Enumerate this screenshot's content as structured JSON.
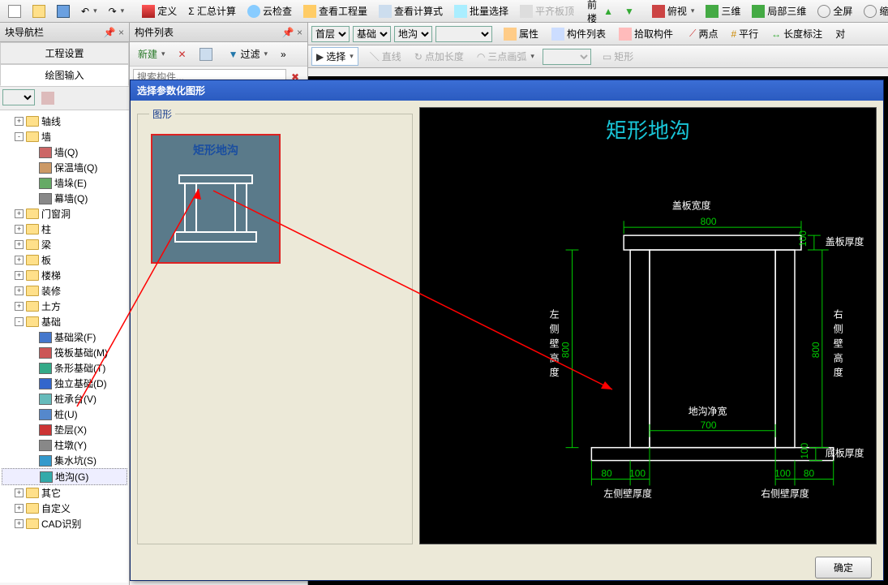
{
  "top_toolbar": {
    "define": "定义",
    "sum": "Σ 汇总计算",
    "cloud": "云检查",
    "view_qty": "查看工程量",
    "view_calc": "查看计算式",
    "batch": "批量选择",
    "flat": "平齐板顶",
    "cur_floor_lbl": "当前楼层",
    "perspective": "俯视",
    "threeD": "三维",
    "local3d": "局部三维",
    "fullscreen": "全屏",
    "zoom": "缩放"
  },
  "toolbar2": {
    "floor": "首层",
    "basis": "基础",
    "ditch": "地沟",
    "prop": "属性",
    "list": "构件列表",
    "pick": "拾取构件",
    "two_pt": "两点",
    "parallel": "平行",
    "len_dim": "长度标注",
    "align": "对"
  },
  "toolbar3": {
    "select": "选择",
    "line": "直线",
    "arc_len": "点加长度",
    "three_arc": "三点画弧",
    "rect": "矩形"
  },
  "left": {
    "title": "块导航栏",
    "tab1": "工程设置",
    "tab2": "绘图输入",
    "tree": [
      {
        "lvl": 0,
        "exp": "+",
        "fold": true,
        "label": "轴线"
      },
      {
        "lvl": 0,
        "exp": "-",
        "fold": true,
        "label": "墙"
      },
      {
        "lvl": 1,
        "ico": "#c66",
        "label": "墙(Q)"
      },
      {
        "lvl": 1,
        "ico": "#c96",
        "label": "保温墙(Q)"
      },
      {
        "lvl": 1,
        "ico": "#6a6",
        "label": "墙垛(E)"
      },
      {
        "lvl": 1,
        "ico": "#888",
        "label": "幕墙(Q)"
      },
      {
        "lvl": 0,
        "exp": "+",
        "fold": true,
        "label": "门窗洞"
      },
      {
        "lvl": 0,
        "exp": "+",
        "fold": true,
        "label": "柱"
      },
      {
        "lvl": 0,
        "exp": "+",
        "fold": true,
        "label": "梁"
      },
      {
        "lvl": 0,
        "exp": "+",
        "fold": true,
        "label": "板"
      },
      {
        "lvl": 0,
        "exp": "+",
        "fold": true,
        "label": "楼梯"
      },
      {
        "lvl": 0,
        "exp": "+",
        "fold": true,
        "label": "装修"
      },
      {
        "lvl": 0,
        "exp": "+",
        "fold": true,
        "label": "土方"
      },
      {
        "lvl": 0,
        "exp": "-",
        "fold": true,
        "label": "基础"
      },
      {
        "lvl": 1,
        "ico": "#47c",
        "label": "基础梁(F)"
      },
      {
        "lvl": 1,
        "ico": "#c55",
        "label": "筏板基础(M)"
      },
      {
        "lvl": 1,
        "ico": "#3a8",
        "label": "条形基础(T)"
      },
      {
        "lvl": 1,
        "ico": "#36c",
        "label": "独立基础(D)"
      },
      {
        "lvl": 1,
        "ico": "#6bb",
        "label": "桩承台(V)"
      },
      {
        "lvl": 1,
        "ico": "#58c",
        "label": "桩(U)"
      },
      {
        "lvl": 1,
        "ico": "#c33",
        "label": "垫层(X)"
      },
      {
        "lvl": 1,
        "ico": "#888",
        "label": "柱墩(Y)"
      },
      {
        "lvl": 1,
        "ico": "#39c",
        "label": "集水坑(S)"
      },
      {
        "lvl": 1,
        "ico": "#3aa",
        "label": "地沟(G)",
        "sel": true
      },
      {
        "lvl": 0,
        "exp": "+",
        "fold": true,
        "label": "其它"
      },
      {
        "lvl": 0,
        "exp": "+",
        "fold": true,
        "label": "自定义"
      },
      {
        "lvl": 0,
        "exp": "+",
        "fold": true,
        "label": "CAD识别"
      }
    ]
  },
  "mid": {
    "title": "构件列表",
    "new": "新建",
    "filter": "过滤",
    "search_ph": "搜索构件..."
  },
  "dialog": {
    "title": "选择参数化图形",
    "group": "图形",
    "thumb": "矩形地沟",
    "ok": "确定",
    "cad": {
      "title": "矩形地沟",
      "cover_w_lbl": "盖板宽度",
      "cover_w": "800",
      "cover_t_lbl": "盖板厚度",
      "cover_t": "100",
      "left_h_lbl": "左侧壁高度",
      "left_h": "800",
      "right_h_lbl": "右侧壁高度",
      "right_h": "800",
      "inner_w_lbl": "地沟净宽",
      "inner_w": "700",
      "bottom_t_lbl": "底板厚度",
      "bottom_t": "100",
      "left_t_lbl": "左侧壁厚度",
      "left_t1": "80",
      "left_t2": "100",
      "right_t_lbl": "右侧壁厚度",
      "right_t1": "100",
      "right_t2": "80"
    }
  }
}
